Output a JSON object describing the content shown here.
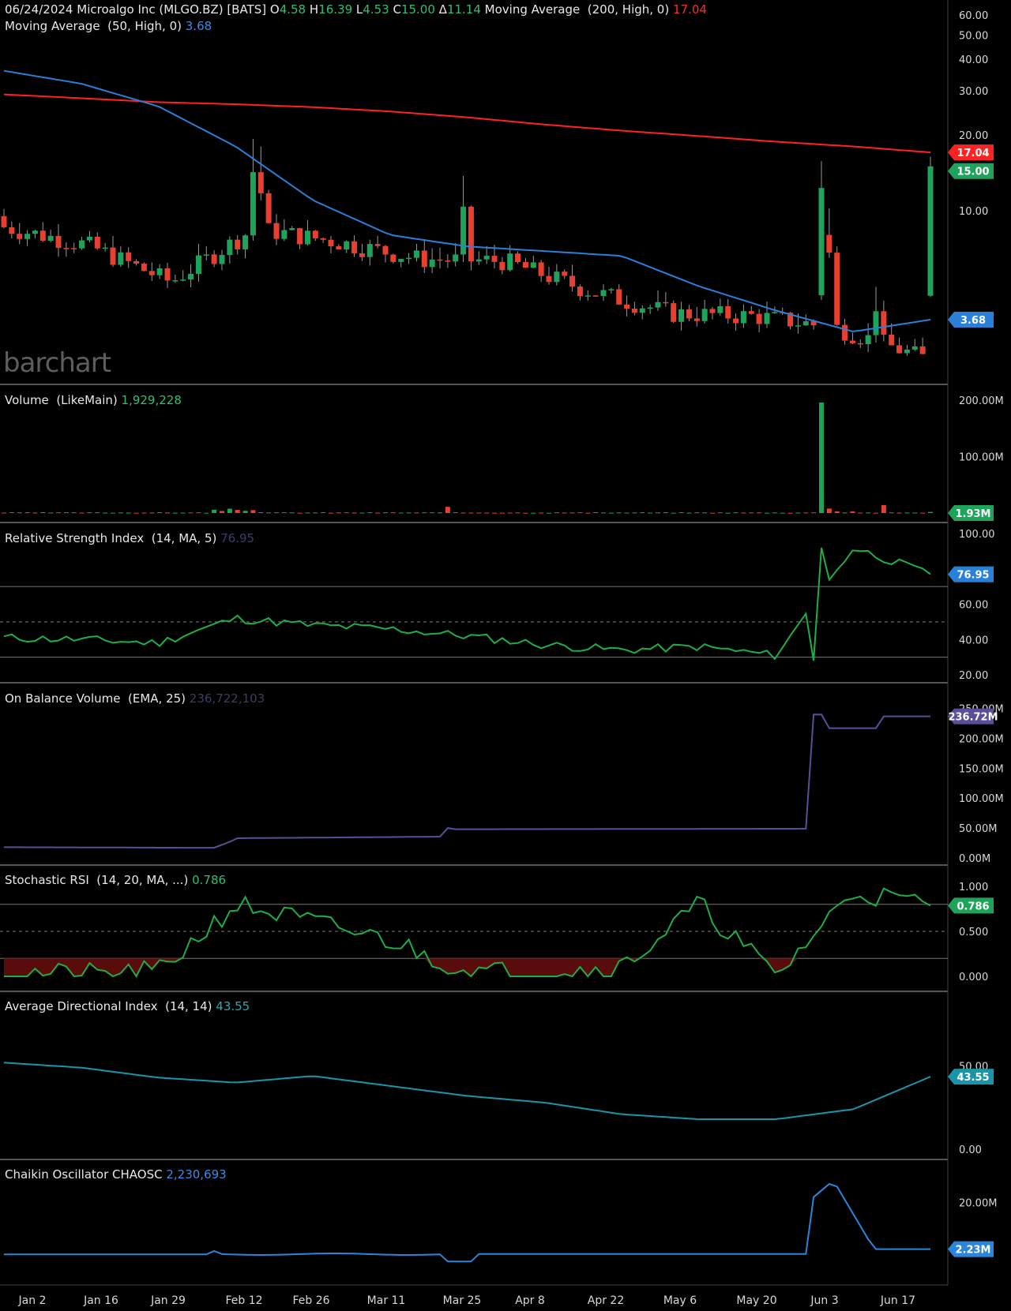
{
  "header": {
    "date": "06/24/2024",
    "name": "Microalgo Inc (MLGO.BZ) [BATS]",
    "open_label": "O",
    "open": "4.58",
    "high_label": "H",
    "high": "16.39",
    "low_label": "L",
    "low": "4.53",
    "close_label": "C",
    "close": "15.00",
    "change_label": "Δ",
    "change": "11.14",
    "ma200_label": "Moving Average  (200, High, 0)",
    "ma200_value": "17.04",
    "ma50_label": "Moving Average  (50, High, 0)",
    "ma50_value": "3.68"
  },
  "watermark": "barchart",
  "colors": {
    "up": "#1fa35a",
    "down": "#e8402f",
    "ma200": "#ff2222",
    "ma50": "#2a7fd8",
    "rsi": "#1fae46",
    "obv": "#5a4e9a",
    "adx": "#1a94a8",
    "chaikin": "#2a86dc",
    "grid": "#777777",
    "separator": "#555555"
  },
  "x_axis": {
    "labels": [
      "Jan 2",
      "Jan 16",
      "Jan 29",
      "Feb 12",
      "Feb 26",
      "Mar 11",
      "Mar 25",
      "Apr 8",
      "Apr 22",
      "May 6",
      "May 20",
      "Jun 3",
      "Jun 17"
    ]
  },
  "panes": {
    "price": {
      "ticks": [
        "60.00",
        "50.00",
        "40.00",
        "30.00",
        "20.00",
        "10.00"
      ],
      "badges": [
        "17.04",
        "15.00",
        "3.68"
      ]
    },
    "volume": {
      "label": "Volume  (LikeMain)",
      "value": "1,929,228",
      "ticks": [
        "200.00M",
        "100.00M"
      ],
      "badge": "1.93M"
    },
    "rsi": {
      "label": "Relative Strength Index  (14, MA, 5)",
      "value": "76.95",
      "ticks": [
        "100.00",
        "60.00",
        "40.00",
        "20.00"
      ],
      "badge": "76.95"
    },
    "obv": {
      "label": "On Balance Volume  (EMA, 25)",
      "value": "236,722,103",
      "ticks": [
        "250.00M",
        "200.00M",
        "150.00M",
        "100.00M",
        "50.00M",
        "0.00M"
      ],
      "badge": "236.72M"
    },
    "stochrsi": {
      "label": "Stochastic RSI  (14, 20, MA, ...)",
      "value": "0.786",
      "ticks": [
        "1.000",
        "0.500",
        "0.000"
      ],
      "badge": "0.786"
    },
    "adx": {
      "label": "Average Directional Index  (14, 14)",
      "value": "43.55",
      "ticks": [
        "50.00",
        "0.00"
      ],
      "badge": "43.55"
    },
    "chaikin": {
      "label": "Chaikin Oscillator CHAOSC",
      "value": "2,230,693",
      "ticks": [
        "20.00M"
      ],
      "badge": "2.23M"
    }
  },
  "chart_data": [
    {
      "type": "candlestick",
      "pane": "price",
      "scale": "log",
      "ylim": [
        2.3,
        65
      ],
      "x": [
        "Jan 2",
        "Jan 16",
        "Jan 29",
        "Feb 12",
        "Feb 26",
        "Mar 11",
        "Mar 25",
        "Apr 8",
        "Apr 22",
        "May 6",
        "May 20",
        "Jun 3",
        "Jun 17"
      ],
      "series": [
        {
          "name": "Moving Average (200, High, 0)",
          "values": [
            29.0,
            28.0,
            27.0,
            26.5,
            25.8,
            24.8,
            23.5,
            22.0,
            20.8,
            19.8,
            18.8,
            18.0,
            17.04
          ]
        },
        {
          "name": "Moving Average (50, High, 0)",
          "values": [
            36.0,
            32.0,
            26.0,
            18.0,
            11.0,
            8.0,
            7.2,
            6.9,
            6.6,
            5.0,
            4.0,
            3.3,
            3.68
          ]
        }
      ],
      "closes": [
        8.6,
        7.3,
        5.2,
        8.5,
        7.5,
        6.4,
        6.3,
        4.8,
        3.9,
        3.8,
        3.4,
        2.6,
        15.0
      ],
      "last": {
        "open": 4.58,
        "high": 16.39,
        "low": 4.53,
        "close": 15.0
      }
    },
    {
      "type": "bar",
      "pane": "volume",
      "ylim": [
        0,
        210
      ],
      "unit": "M",
      "x": [
        "Jan 2",
        "Feb 12",
        "Mar 25",
        "Jun 3",
        "Jun 17"
      ],
      "values": [
        1,
        6,
        11,
        196,
        1.93
      ]
    },
    {
      "type": "line",
      "pane": "rsi",
      "ylim": [
        20,
        100
      ],
      "x": [
        "Jan 2",
        "Jan 16",
        "Jan 29",
        "Feb 12",
        "Feb 26",
        "Mar 11",
        "Mar 25",
        "Apr 8",
        "Apr 22",
        "May 6",
        "May 20",
        "Jun 3",
        "Jun 17"
      ],
      "values": [
        41,
        40,
        38,
        52,
        48,
        46,
        42,
        37,
        34,
        36,
        31,
        92,
        76.95
      ]
    },
    {
      "type": "line",
      "pane": "obv",
      "ylim": [
        0,
        250
      ],
      "unit": "M",
      "x": [
        "Jan 2",
        "Jan 29",
        "Feb 12",
        "Mar 25",
        "Apr 8",
        "May 20",
        "Jun 3",
        "Jun 17"
      ],
      "values": [
        18,
        17,
        33,
        50,
        47,
        49,
        240,
        236.72
      ]
    },
    {
      "type": "line",
      "pane": "stochrsi",
      "ylim": [
        0,
        1
      ],
      "x": [
        "Jan 2",
        "Jan 16",
        "Jan 29",
        "Feb 12",
        "Feb 26",
        "Mar 11",
        "Mar 25",
        "Apr 8",
        "Apr 22",
        "May 6",
        "May 20",
        "Jun 3",
        "Jun 17"
      ],
      "values": [
        0.05,
        0.02,
        0.05,
        0.8,
        0.6,
        0.4,
        0.05,
        0.05,
        0.1,
        0.8,
        0.0,
        0.95,
        0.786
      ]
    },
    {
      "type": "line",
      "pane": "adx",
      "ylim": [
        0,
        55
      ],
      "x": [
        "Jan 2",
        "Jan 16",
        "Jan 29",
        "Feb 12",
        "Feb 26",
        "Mar 11",
        "Mar 25",
        "Apr 8",
        "Apr 22",
        "May 6",
        "May 20",
        "Jun 3",
        "Jun 17"
      ],
      "values": [
        52,
        49,
        43,
        40,
        44,
        38,
        32,
        28,
        21,
        18,
        18,
        24,
        43.55
      ]
    },
    {
      "type": "line",
      "pane": "chaikin",
      "ylim": [
        -3,
        30
      ],
      "unit": "M",
      "x": [
        "Jan 2",
        "Jan 16",
        "Jan 29",
        "Feb 12",
        "Feb 26",
        "Mar 11",
        "Mar 25",
        "Apr 8",
        "Apr 22",
        "May 6",
        "May 20",
        "Jun 3",
        "Jun 17"
      ],
      "values": [
        0,
        0.5,
        1,
        0,
        0.5,
        1.2,
        -2.5,
        0,
        0.5,
        0.5,
        0.3,
        27,
        2.23
      ]
    }
  ]
}
